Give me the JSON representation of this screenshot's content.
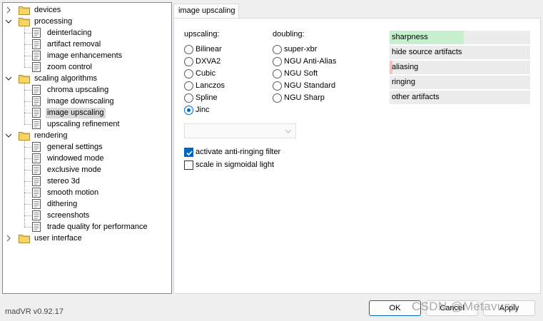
{
  "tree": {
    "items": [
      {
        "label": "devices",
        "type": "folder",
        "level": 0,
        "expanded": false
      },
      {
        "label": "processing",
        "type": "folder",
        "level": 0,
        "expanded": true
      },
      {
        "label": "deinterlacing",
        "type": "page",
        "level": 1
      },
      {
        "label": "artifact removal",
        "type": "page",
        "level": 1
      },
      {
        "label": "image enhancements",
        "type": "page",
        "level": 1
      },
      {
        "label": "zoom control",
        "type": "page",
        "level": 1
      },
      {
        "label": "scaling algorithms",
        "type": "folder",
        "level": 0,
        "expanded": true
      },
      {
        "label": "chroma upscaling",
        "type": "page",
        "level": 1
      },
      {
        "label": "image downscaling",
        "type": "page",
        "level": 1
      },
      {
        "label": "image upscaling",
        "type": "page",
        "level": 1,
        "selected": true
      },
      {
        "label": "upscaling refinement",
        "type": "page",
        "level": 1
      },
      {
        "label": "rendering",
        "type": "folder",
        "level": 0,
        "expanded": true
      },
      {
        "label": "general settings",
        "type": "page",
        "level": 1
      },
      {
        "label": "windowed mode",
        "type": "page",
        "level": 1
      },
      {
        "label": "exclusive mode",
        "type": "page",
        "level": 1
      },
      {
        "label": "stereo 3d",
        "type": "page",
        "level": 1
      },
      {
        "label": "smooth motion",
        "type": "page",
        "level": 1
      },
      {
        "label": "dithering",
        "type": "page",
        "level": 1
      },
      {
        "label": "screenshots",
        "type": "page",
        "level": 1
      },
      {
        "label": "trade quality for performance",
        "type": "page",
        "level": 1
      },
      {
        "label": "user interface",
        "type": "folder",
        "level": 0,
        "expanded": false
      }
    ]
  },
  "tab": {
    "label": "image upscaling"
  },
  "upscaling": {
    "label": "upscaling:",
    "options": [
      "Bilinear",
      "DXVA2",
      "Cubic",
      "Lanczos",
      "Spline",
      "Jinc"
    ],
    "selected": "Jinc"
  },
  "doubling": {
    "label": "doubling:",
    "options": [
      "super-xbr",
      "NGU Anti-Alias",
      "NGU Soft",
      "NGU Standard",
      "NGU Sharp"
    ],
    "selected": null
  },
  "combo": {
    "value": ""
  },
  "checks": [
    {
      "label": "activate anti-ringing filter",
      "checked": true
    },
    {
      "label": "scale in sigmoidal light",
      "checked": false
    }
  ],
  "meters": [
    {
      "label": "sharpness",
      "level": 0.53,
      "color": "#c6efce"
    },
    {
      "label": "hide source artifacts",
      "level": 0.0,
      "color": "#c6efce"
    },
    {
      "label": "aliasing",
      "level": 0.02,
      "color": "#f8c0c0"
    },
    {
      "label": "ringing",
      "level": 0.0,
      "color": "#f8c0c0"
    },
    {
      "label": "other artifacts",
      "level": 0.0,
      "color": "#f8c0c0"
    }
  ],
  "footer": {
    "version": "madVR v0.92.17",
    "ok": "OK",
    "cancel": "Cancel",
    "apply": "Apply",
    "watermark": "CSDN @Metavuse"
  },
  "colors": {
    "accent": "#0067c0",
    "folder": "#f5d66b",
    "selected": "#d9d9d9"
  }
}
